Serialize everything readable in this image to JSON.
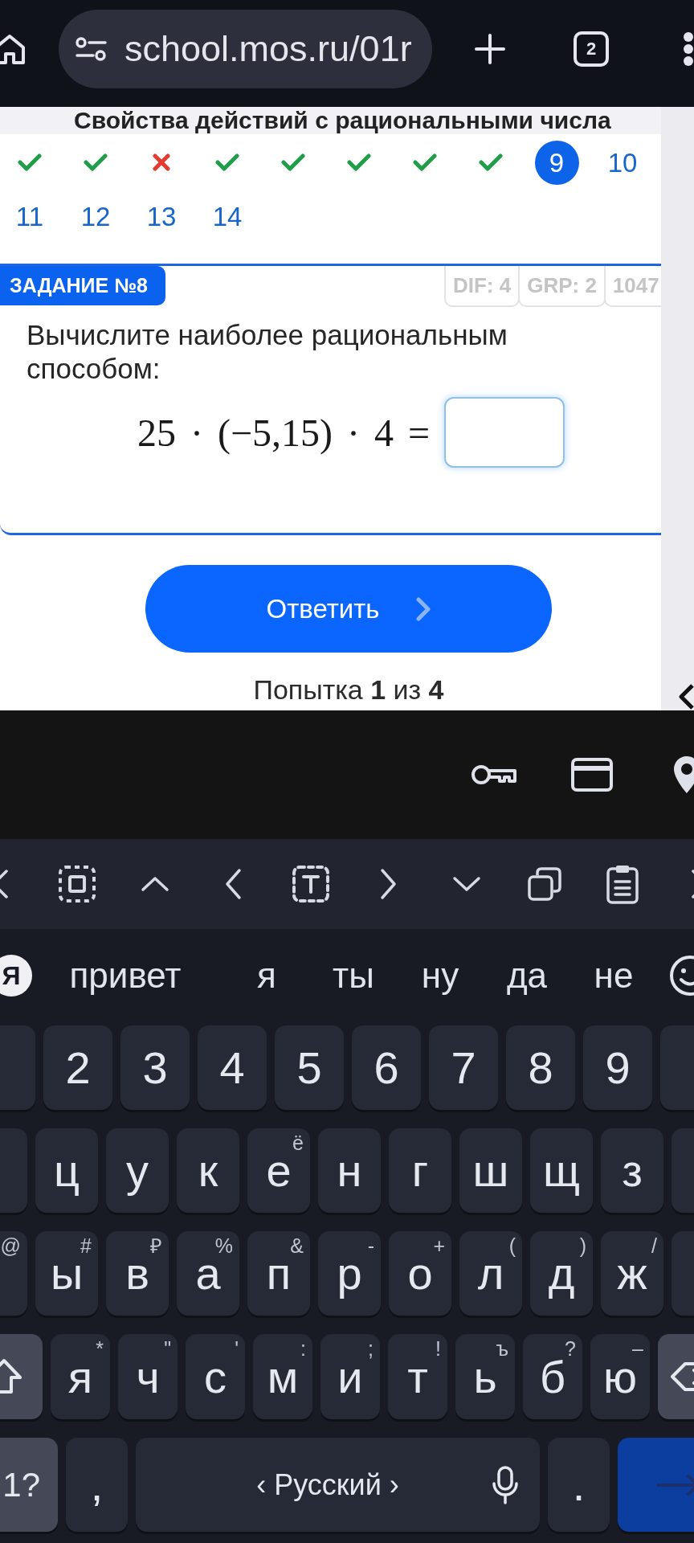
{
  "browser": {
    "url": "school.mos.ru/01r",
    "tab_count": "2"
  },
  "page": {
    "heading": "Свойства действий с рациональными числа",
    "tasks": [
      {
        "kind": "check",
        "selected": false
      },
      {
        "kind": "check",
        "selected": false
      },
      {
        "kind": "cross",
        "selected": false
      },
      {
        "kind": "check",
        "selected": false
      },
      {
        "kind": "check",
        "selected": false
      },
      {
        "kind": "check",
        "selected": false
      },
      {
        "kind": "check",
        "selected": false
      },
      {
        "kind": "check",
        "selected": false
      },
      {
        "kind": "number",
        "label": "9",
        "selected": true
      },
      {
        "kind": "number",
        "label": "10",
        "selected": false
      },
      {
        "kind": "number",
        "label": "11",
        "selected": false
      },
      {
        "kind": "number",
        "label": "12",
        "selected": false
      },
      {
        "kind": "number",
        "label": "13",
        "selected": false
      },
      {
        "kind": "number",
        "label": "14",
        "selected": false
      }
    ],
    "task_card": {
      "badge": "ЗАДАНИЕ №8",
      "tags": [
        "DIF: 4",
        "GRP: 2",
        "1047"
      ],
      "question": "Вычислите наиболее рациональным способом:",
      "expression": "25 · (−5,15) · 4 ="
    },
    "submit_button": "Ответить",
    "attempt": "Попытка **1** из **4**"
  },
  "keyboard": {
    "logo": "Я",
    "suggestions": [
      "привет",
      "я",
      "ты",
      "ну",
      "да",
      "не"
    ],
    "rows": [
      {
        "keys": [
          {
            "kind": "edge"
          },
          {
            "kind": "char",
            "label": "2"
          },
          {
            "kind": "char",
            "label": "3"
          },
          {
            "kind": "char",
            "label": "4"
          },
          {
            "kind": "char",
            "label": "5"
          },
          {
            "kind": "char",
            "label": "6"
          },
          {
            "kind": "char",
            "label": "7"
          },
          {
            "kind": "char",
            "label": "8"
          },
          {
            "kind": "char",
            "label": "9"
          },
          {
            "kind": "edge"
          }
        ]
      },
      {
        "keys": [
          {
            "kind": "edge"
          },
          {
            "kind": "char",
            "label": "ц"
          },
          {
            "kind": "char",
            "label": "у"
          },
          {
            "kind": "char",
            "label": "к"
          },
          {
            "kind": "char",
            "label": "е",
            "hint": "ё"
          },
          {
            "kind": "char",
            "label": "н"
          },
          {
            "kind": "char",
            "label": "г"
          },
          {
            "kind": "char",
            "label": "ш"
          },
          {
            "kind": "char",
            "label": "щ"
          },
          {
            "kind": "char",
            "label": "з"
          },
          {
            "kind": "edge"
          }
        ]
      },
      {
        "keys": [
          {
            "kind": "edge",
            "hint": "@"
          },
          {
            "kind": "char",
            "label": "ы",
            "hint": "#"
          },
          {
            "kind": "char",
            "label": "в",
            "hint": "₽"
          },
          {
            "kind": "char",
            "label": "а",
            "hint": "%"
          },
          {
            "kind": "char",
            "label": "п",
            "hint": "&"
          },
          {
            "kind": "char",
            "label": "р",
            "hint": "-"
          },
          {
            "kind": "char",
            "label": "о",
            "hint": "+"
          },
          {
            "kind": "char",
            "label": "л",
            "hint": "("
          },
          {
            "kind": "char",
            "label": "д",
            "hint": ")"
          },
          {
            "kind": "char",
            "label": "ж",
            "hint": "/"
          },
          {
            "kind": "edge"
          }
        ]
      },
      {
        "keys": [
          {
            "kind": "shift"
          },
          {
            "kind": "char",
            "label": "я",
            "hint": "*"
          },
          {
            "kind": "char",
            "label": "ч",
            "hint": "\""
          },
          {
            "kind": "char",
            "label": "с",
            "hint": "'"
          },
          {
            "kind": "char",
            "label": "м",
            "hint": ":"
          },
          {
            "kind": "char",
            "label": "и",
            "hint": ";"
          },
          {
            "kind": "char",
            "label": "т",
            "hint": "!"
          },
          {
            "kind": "char",
            "label": "ь",
            "hint": "ъ"
          },
          {
            "kind": "char",
            "label": "б",
            "hint": "?"
          },
          {
            "kind": "char",
            "label": "ю",
            "hint": "–"
          },
          {
            "kind": "backspace"
          }
        ]
      },
      {
        "keys": [
          {
            "kind": "mode",
            "label": "1?"
          },
          {
            "kind": "char",
            "label": ","
          },
          {
            "kind": "space",
            "label": "‹ Русский ›"
          },
          {
            "kind": "char",
            "label": "."
          },
          {
            "kind": "enter"
          }
        ]
      }
    ]
  }
}
